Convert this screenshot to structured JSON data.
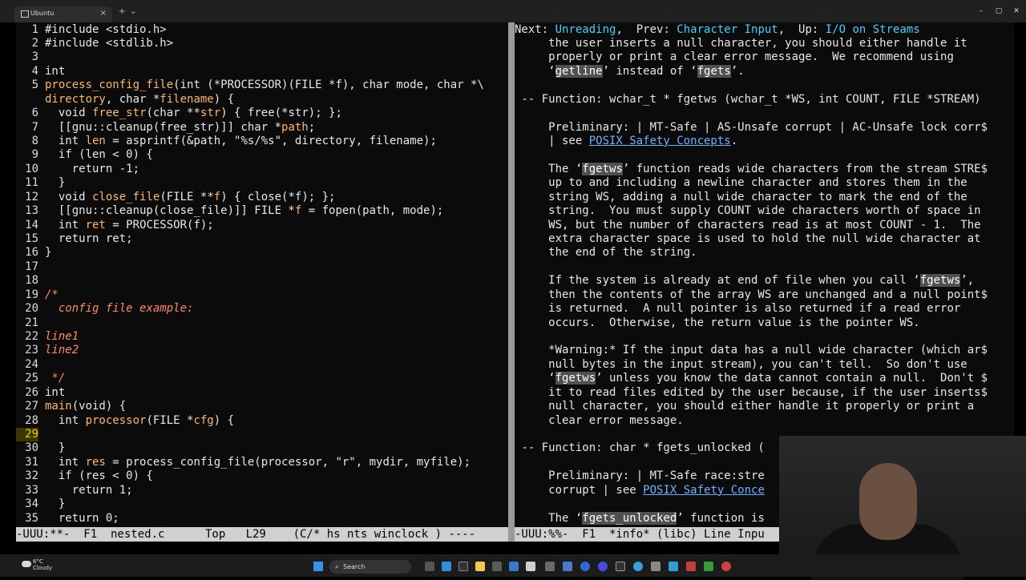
{
  "window": {
    "tab_title": "Ubuntu",
    "tab_close": "×",
    "new_tab": "+",
    "tab_dropdown": "⌄",
    "minimize": "–",
    "maximize": "▢",
    "close": "✕"
  },
  "editor": {
    "current_line": 29,
    "lines": [
      {
        "n": "1",
        "segs": [
          {
            "t": "#include <stdio.h>",
            "c": "ml"
          }
        ]
      },
      {
        "n": "2",
        "segs": [
          {
            "t": "#include <stdlib.h>",
            "c": "ml"
          }
        ]
      },
      {
        "n": "3",
        "segs": []
      },
      {
        "n": "4",
        "segs": [
          {
            "t": "int",
            "c": "ty"
          }
        ]
      },
      {
        "n": "5",
        "segs": [
          {
            "t": "process_config_file",
            "c": "fn"
          },
          {
            "t": "(int (*PROCESSOR)(FILE *f), char mode, char *\\",
            "c": "ml"
          }
        ]
      },
      {
        "n": "",
        "segs": [
          {
            "t": "directory",
            "c": "fn"
          },
          {
            "t": ", char *",
            "c": "ml"
          },
          {
            "t": "filename",
            "c": "fn"
          },
          {
            "t": ") {",
            "c": "ml"
          }
        ]
      },
      {
        "n": "6",
        "segs": [
          {
            "t": "  void ",
            "c": "ml"
          },
          {
            "t": "free_str",
            "c": "fn"
          },
          {
            "t": "(char **",
            "c": "ml"
          },
          {
            "t": "str",
            "c": "fn"
          },
          {
            "t": ") { free(*str); };",
            "c": "ml"
          }
        ]
      },
      {
        "n": "7",
        "segs": [
          {
            "t": "  [[gnu::cleanup(free_str)]] char *",
            "c": "ml"
          },
          {
            "t": "path",
            "c": "fn"
          },
          {
            "t": ";",
            "c": "ml"
          }
        ]
      },
      {
        "n": "8",
        "segs": [
          {
            "t": "  int ",
            "c": "ml"
          },
          {
            "t": "len",
            "c": "fn"
          },
          {
            "t": " = asprintf(&path, \"%s/%s\", directory, filename);",
            "c": "ml"
          }
        ]
      },
      {
        "n": "9",
        "segs": [
          {
            "t": "  if (len < 0) {",
            "c": "ml"
          }
        ]
      },
      {
        "n": "10",
        "segs": [
          {
            "t": "    return -1;",
            "c": "ml"
          }
        ]
      },
      {
        "n": "11",
        "segs": [
          {
            "t": "  }",
            "c": "ml"
          }
        ]
      },
      {
        "n": "12",
        "segs": [
          {
            "t": "  void ",
            "c": "ml"
          },
          {
            "t": "close_file",
            "c": "fn"
          },
          {
            "t": "(FILE **",
            "c": "ml"
          },
          {
            "t": "f",
            "c": "fn"
          },
          {
            "t": ") { close(*f); };",
            "c": "ml"
          }
        ]
      },
      {
        "n": "13",
        "segs": [
          {
            "t": "  [[gnu::cleanup(close_file)]] FILE *",
            "c": "ml"
          },
          {
            "t": "f",
            "c": "fn"
          },
          {
            "t": " = fopen(path, mode);",
            "c": "ml"
          }
        ]
      },
      {
        "n": "14",
        "segs": [
          {
            "t": "  int ",
            "c": "ml"
          },
          {
            "t": "ret",
            "c": "fn"
          },
          {
            "t": " = PROCESSOR(f);",
            "c": "ml"
          }
        ]
      },
      {
        "n": "15",
        "segs": [
          {
            "t": "  return ret;",
            "c": "ml"
          }
        ]
      },
      {
        "n": "16",
        "segs": [
          {
            "t": "}",
            "c": "ml"
          }
        ]
      },
      {
        "n": "17",
        "segs": []
      },
      {
        "n": "18",
        "segs": []
      },
      {
        "n": "19",
        "segs": [
          {
            "t": "/*",
            "c": "cm"
          }
        ]
      },
      {
        "n": "20",
        "segs": [
          {
            "t": "  config file example:",
            "c": "cm"
          }
        ]
      },
      {
        "n": "21",
        "segs": []
      },
      {
        "n": "22",
        "segs": [
          {
            "t": "line1",
            "c": "cm"
          }
        ]
      },
      {
        "n": "23",
        "segs": [
          {
            "t": "line2",
            "c": "cm"
          }
        ]
      },
      {
        "n": "24",
        "segs": []
      },
      {
        "n": "25",
        "segs": [
          {
            "t": " */",
            "c": "cm"
          }
        ]
      },
      {
        "n": "26",
        "segs": [
          {
            "t": "int",
            "c": "ty"
          }
        ]
      },
      {
        "n": "27",
        "segs": [
          {
            "t": "main",
            "c": "fn"
          },
          {
            "t": "(void) {",
            "c": "ml"
          }
        ]
      },
      {
        "n": "28",
        "segs": [
          {
            "t": "  int ",
            "c": "ml"
          },
          {
            "t": "processor",
            "c": "fn"
          },
          {
            "t": "(FILE *",
            "c": "ml"
          },
          {
            "t": "cfg",
            "c": "fn"
          },
          {
            "t": ") {",
            "c": "ml"
          }
        ]
      },
      {
        "n": "29",
        "segs": []
      },
      {
        "n": "30",
        "segs": [
          {
            "t": "  }",
            "c": "ml"
          }
        ]
      },
      {
        "n": "31",
        "segs": [
          {
            "t": "  int ",
            "c": "ml"
          },
          {
            "t": "res",
            "c": "fn"
          },
          {
            "t": " = process_config_file(processor, \"r\", mydir, myfile);",
            "c": "ml"
          }
        ]
      },
      {
        "n": "32",
        "segs": [
          {
            "t": "  if (res < 0) {",
            "c": "ml"
          }
        ]
      },
      {
        "n": "33",
        "segs": [
          {
            "t": "    return 1;",
            "c": "ml"
          }
        ]
      },
      {
        "n": "34",
        "segs": [
          {
            "t": "  }",
            "c": "ml"
          }
        ]
      },
      {
        "n": "35",
        "segs": [
          {
            "t": "  return 0;",
            "c": "ml"
          }
        ]
      }
    ],
    "status": "-UUU:**-  F1  nested.c      Top   L29    (C/* hs nts winclock ) ----"
  },
  "info": {
    "lines": [
      [
        {
          "t": "Next: ",
          "c": "ml"
        },
        {
          "t": "Unreading",
          "c": "hdr"
        },
        {
          "t": ",  Prev: ",
          "c": "ml"
        },
        {
          "t": "Character Input",
          "c": "hdr"
        },
        {
          "t": ",  Up: ",
          "c": "ml"
        },
        {
          "t": "I/O on Streams",
          "c": "hdr"
        }
      ],
      [
        {
          "t": "     the user inserts a null character, you should either handle it",
          "c": "ml"
        }
      ],
      [
        {
          "t": "     properly or print a clear error message.  We recommend using",
          "c": "ml"
        }
      ],
      [
        {
          "t": "     ‘",
          "c": "ml"
        },
        {
          "t": "getline",
          "c": "hlw"
        },
        {
          "t": "’ instead of ‘",
          "c": "ml"
        },
        {
          "t": "fgets",
          "c": "hlw"
        },
        {
          "t": "’.",
          "c": "ml"
        }
      ],
      [],
      [
        {
          "t": " -- Function: wchar_t * fgetws (wchar_t *WS, int COUNT, FILE *STREAM)",
          "c": "ml"
        }
      ],
      [],
      [
        {
          "t": "     Preliminary: | MT-Safe | AS-Unsafe corrupt | AC-Unsafe lock corr$",
          "c": "ml"
        }
      ],
      [
        {
          "t": "     | see ",
          "c": "ml"
        },
        {
          "t": "POSIX Safety Concepts",
          "c": "lnk"
        },
        {
          "t": ".",
          "c": "ml"
        }
      ],
      [],
      [
        {
          "t": "     The ‘",
          "c": "ml"
        },
        {
          "t": "fgetws",
          "c": "hlw"
        },
        {
          "t": "’ function reads wide characters from the stream STRE$",
          "c": "ml"
        }
      ],
      [
        {
          "t": "     up to and including a newline character and stores them in the",
          "c": "ml"
        }
      ],
      [
        {
          "t": "     string WS, adding a null wide character to mark the end of the",
          "c": "ml"
        }
      ],
      [
        {
          "t": "     string.  You must supply COUNT wide characters worth of space in",
          "c": "ml"
        }
      ],
      [
        {
          "t": "     WS, but the number of characters read is at most COUNT - 1.  The",
          "c": "ml"
        }
      ],
      [
        {
          "t": "     extra character space is used to hold the null wide character at",
          "c": "ml"
        }
      ],
      [
        {
          "t": "     the end of the string.",
          "c": "ml"
        }
      ],
      [],
      [
        {
          "t": "     If the system is already at end of file when you call ‘",
          "c": "ml"
        },
        {
          "t": "fgetws",
          "c": "hlw"
        },
        {
          "t": "’,",
          "c": "ml"
        }
      ],
      [
        {
          "t": "     then the contents of the array WS are unchanged and a null point$",
          "c": "ml"
        }
      ],
      [
        {
          "t": "     is returned.  A null pointer is also returned if a read error",
          "c": "ml"
        }
      ],
      [
        {
          "t": "     occurs.  Otherwise, the return value is the pointer WS.",
          "c": "ml"
        }
      ],
      [],
      [
        {
          "t": "     *Warning:* If the input data has a null wide character (which ar$",
          "c": "ml"
        }
      ],
      [
        {
          "t": "     null bytes in the input stream), you can't tell.  So don't use",
          "c": "ml"
        }
      ],
      [
        {
          "t": "     ‘",
          "c": "ml"
        },
        {
          "t": "fgetws",
          "c": "hlw"
        },
        {
          "t": "’ unless you know the data cannot contain a null.  Don't $",
          "c": "ml"
        }
      ],
      [
        {
          "t": "     it to read files edited by the user because, if the user inserts$",
          "c": "ml"
        }
      ],
      [
        {
          "t": "     null character, you should either handle it properly or print a",
          "c": "ml"
        }
      ],
      [
        {
          "t": "     clear error message.",
          "c": "ml"
        }
      ],
      [],
      [
        {
          "t": " -- Function: char * fgets_unlocked (",
          "c": "ml"
        }
      ],
      [],
      [
        {
          "t": "     Preliminary: | MT-Safe race:stre",
          "c": "ml"
        }
      ],
      [
        {
          "t": "     corrupt | see ",
          "c": "ml"
        },
        {
          "t": "POSIX Safety Conce",
          "c": "lnk"
        }
      ],
      [],
      [
        {
          "t": "     The ‘",
          "c": "ml"
        },
        {
          "t": "fgets_unlocked",
          "c": "hlw"
        },
        {
          "t": "’ function is",
          "c": "ml"
        }
      ]
    ],
    "status": "-UUU:%%-  F1  *info* (libc) Line Inpu"
  },
  "taskbar": {
    "weather_temp": "6°C",
    "weather_desc": "Cloudy",
    "search_placeholder": "Search",
    "search_icon": "⌕"
  },
  "colors": {
    "terminal_bg": "#0b0b0b",
    "status_bg": "#d0d0d0",
    "function_name": "#ffb866",
    "comment": "#ff8a5c",
    "info_header_link": "#40d0ff",
    "info_link": "#6eb2ff",
    "current_line_number": "#e6d200"
  }
}
